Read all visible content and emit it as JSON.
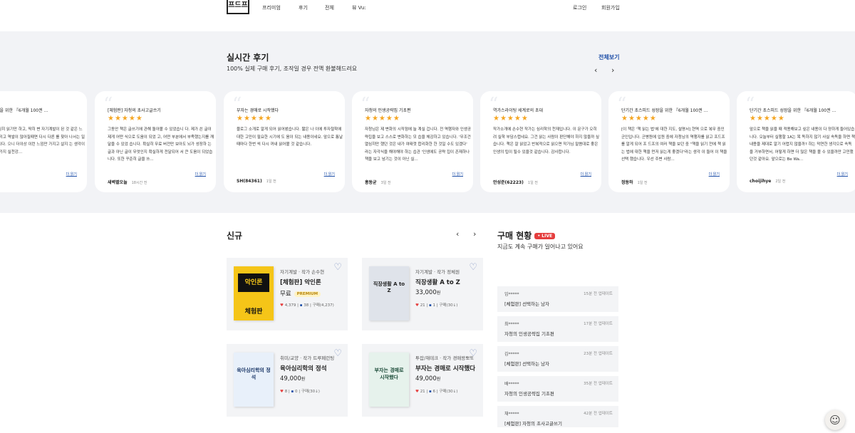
{
  "nav": {
    "logo": "프드프",
    "items": [
      "프리미엄",
      "후기",
      "전체",
      "뷰 Vu:"
    ],
    "login": "로그인",
    "signup": "회원가입"
  },
  "reviews": {
    "title": "실시간 후기",
    "subtitle": "100% 실제 구매 후기, 조작일 경우 전액 환불해드려요",
    "view_all": "전체보기",
    "prev": "‹",
    "next": "›",
    "more_label": "더 읽기",
    "cards": [
      {
        "title": "스피드 성장을 위한 『6개월 100권 ...",
        "stars": "★★★",
        "body": "개발서를 열심히 읽기만 하고, 딱히 변 자기계발이 된 것 같은 느낌으로 살 그리고 역발이 많아질때면 다시 다른 를 찾아 나서는 일을 반복했습니다. 으니 더이상 이런 느낌만 가지고 살지 는 생각이 듭니다. 여러가지 실천강...",
        "author": "",
        "time": "7시간 전"
      },
      {
        "title": "[체험판] 자청의 초사고글쓰기",
        "stars": "★★★★★",
        "body": "그동안 책은 글쓰기에 관해 돌아볼 수 있었습니 다. 제가 쓴 글이 제게 어떤 식으로 도움이 되었 고, 어떤 부분에서 부족했는지를 깨달을 수 있었 습니다. 확실히 무료 버전만 보아도 뇌가 성장하 는 글과 아닌 글이 무엇인지 확실하게 전달되어 서 큰 도움이 되었습니다. 또한 꾸준히 글을 쓰...",
        "author": "새벽별오늘",
        "time": "18시간 전"
      },
      {
        "title": "부자는 경매로 시작했다",
        "stars": "★★★★★",
        "body": "블로그 소개로 알게 되어 읽어봤습니다. 짧은 나 이에 투자철학에 대한 고민이 필요한 시기에 도 움이 되는 내용이네요. 앞으로 틈날때마다 한번 씩 다시 꺼내 읽어볼 것 같습니다.",
        "author": "SH(84361)",
        "time": "1일 전"
      },
      {
        "title": "자청의 인생공략집 기초편",
        "stars": "★★★★★",
        "body": "자청님은 제 변화의 시작점에 늘 계실 겁니다. 전 역행자와 인생공략집을 보고 스스로 변화하는 모 습을 체감하고 있습니다. '무조건 열심히만 했던 것은 내가 여태껏 합리화한 한 것일 수도 있겠다' 라는 자각식을 해야해야 하는 습관 '인생에도 공략 집이 존재하나 책을 보고 넘기는 것이 아닌 실...",
        "author": "홍동균",
        "time": "3일 전"
      },
      {
        "title": "역가스라이팅 세계로의 초대",
        "stars": "★★★★★",
        "body": "작가소개에 손수현 작가는 심리학의 천재입니다. 이 문구가 오히려 실학 부담스럽네요. 그건 읽는 사람이 판단해야 하지 않을까 싶습니다. 책은 잘 읽었고 반복적으로 읽으면 작가님 말씀대로 좋은 인생의 팁이 될수 있을것 같습니다. 감사합니다.",
        "author": "안성준(62223)",
        "time": "1일 전"
      },
      {
        "title": "단기간 초스피드 성장을 위한 『6개월 100권 ...",
        "stars": "★★★★★",
        "body": "[이 책은 '책 읽는 법'에 대한 지도, 설명서] 현역 으로 복무 중인 군인입니다. 군병원에 입원 중에 자청님의 역행자를 읽고 프드프를 알게 되어 프 드프의 여러 책을 보던 중 \"책을 읽기 전에 책 읽 는 법에 대한 책을 먼저 읽는게 좋겠다\"라는 생각 이 들어 이 책을 선택 했습니다. 우선 주변 사람...",
        "author": "정동하",
        "time": "1일 전"
      },
      {
        "title": "단기간 초스피드 성장을 위한 『6개월 100권 ...",
        "stars": "★★★★★",
        "body": "앞으로 책을 읽을 때 적용해보고 싶은 내용이 다 양하게 들어있습니다. 오늘부터 실행할 1A는 목 독하지 않기 사실 속독을 하면 책 내용을 제대로 알기 어렵지 않을까? 하는 막연한 생각으로 속독 을 거부하면서, 어떻게 하면 더 많은 책을 볼 수 있을까만 고민했던것 같아요. 앞으로는 Be Wa...",
        "author": "choijihye",
        "time": "2일 전"
      }
    ]
  },
  "new": {
    "title": "신규",
    "prev": "‹",
    "next": "›",
    "products": [
      {
        "category": "자기계발 · 작가 손수현",
        "name": "[체험판] 악인론",
        "price": "무료",
        "badge": "PREMIUM",
        "likes": "4,379",
        "comments": "38",
        "purchases": "구매(4,237)",
        "cover_title": "악인론",
        "cover_sub": "체험판",
        "cover_color": "#f5c518"
      },
      {
        "category": "자기계발 · 작가 정체원",
        "name": "직장생활 A to Z",
        "price": "33,000",
        "won": "원",
        "likes": "21",
        "comments": "1",
        "purchases": "구매(30↓)",
        "cover_title": "직장생활 A to Z",
        "cover_color": "#dfe3ea"
      },
      {
        "category": "취미/교양 · 작가 트루페런팅",
        "name": "육아심리학의 정석",
        "price": "49,000",
        "won": "원",
        "likes": "8",
        "comments": "0",
        "purchases": "구매(30↓)",
        "cover_title": "육아심리학의 정석",
        "cover_color": "#e8f0fa"
      },
      {
        "category": "투잡/재테크 · 작가 경매왕뽀또",
        "name": "부자는 경매로 시작했다",
        "price": "49,000",
        "won": "원",
        "likes": "21",
        "comments": "6",
        "purchases": "구매(30↓)",
        "cover_title": "부자는 경매로 시작했다",
        "cover_color": "#e6f2ec"
      }
    ]
  },
  "purchases": {
    "title": "구매 현황",
    "live": "• LIVE",
    "subtitle": "지금도 계속 구매가 일어나고 있어요",
    "rows": [
      {
        "who": "임*****",
        "ago": "15분 전",
        "tag": "업데이트",
        "what": "[체험판] 선택하는 남자"
      },
      {
        "who": "최*****",
        "ago": "17분 전",
        "tag": "업데이트",
        "what": "자청의 인생공략집 기초편"
      },
      {
        "who": "김*****",
        "ago": "23분 전",
        "tag": "업데이트",
        "what": "[체험판] 선택하는 남자"
      },
      {
        "who": "배*****",
        "ago": "35분 전",
        "tag": "업데이트",
        "what": "자청의 인생공략집 기초편"
      },
      {
        "who": "채*****",
        "ago": "42분 전",
        "tag": "업데이트",
        "what": "[체험판] 자청의 초사고글쓰기"
      }
    ]
  }
}
